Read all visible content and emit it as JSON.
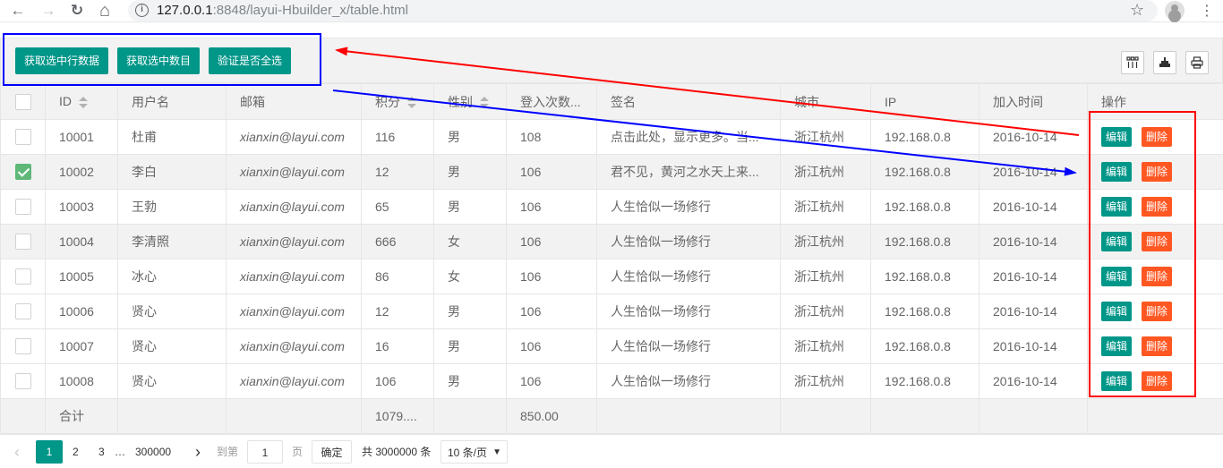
{
  "browser": {
    "back": "←",
    "forward": "→",
    "reload": "↻",
    "home": "⌂",
    "url_host": "127.0.0.1",
    "url_rest": ":8848/layui-Hbuilder_x/table.html",
    "star": "☆",
    "menu": "⋮"
  },
  "toolbar": {
    "btn_get_checked_data": "获取选中行数据",
    "btn_get_checked_count": "获取选中数目",
    "btn_check_all": "验证是否全选",
    "icons": [
      "columns-icon",
      "export-icon",
      "print-icon"
    ]
  },
  "table": {
    "headers": {
      "id": "ID",
      "username": "用户名",
      "email": "邮箱",
      "score": "积分",
      "sex": "性别",
      "logins": "登入次数...",
      "sign": "签名",
      "city": "城市",
      "ip": "IP",
      "join_time": "加入时间",
      "actions": "操作"
    },
    "rows": [
      {
        "checked": false,
        "id": "10001",
        "username": "杜甫",
        "email": "xianxin@layui.com",
        "score": "116",
        "sex": "男",
        "logins": "108",
        "sign": "点击此处，显示更多。当...",
        "city": "浙江杭州",
        "ip": "192.168.0.8",
        "join_time": "2016-10-14"
      },
      {
        "checked": true,
        "id": "10002",
        "username": "李白",
        "email": "xianxin@layui.com",
        "score": "12",
        "sex": "男",
        "logins": "106",
        "sign": "君不见，黄河之水天上来...",
        "city": "浙江杭州",
        "ip": "192.168.0.8",
        "join_time": "2016-10-14"
      },
      {
        "checked": false,
        "id": "10003",
        "username": "王勃",
        "email": "xianxin@layui.com",
        "score": "65",
        "sex": "男",
        "logins": "106",
        "sign": "人生恰似一场修行",
        "city": "浙江杭州",
        "ip": "192.168.0.8",
        "join_time": "2016-10-14"
      },
      {
        "checked": false,
        "id": "10004",
        "username": "李清照",
        "email": "xianxin@layui.com",
        "score": "666",
        "sex": "女",
        "logins": "106",
        "sign": "人生恰似一场修行",
        "city": "浙江杭州",
        "ip": "192.168.0.8",
        "join_time": "2016-10-14"
      },
      {
        "checked": false,
        "id": "10005",
        "username": "冰心",
        "email": "xianxin@layui.com",
        "score": "86",
        "sex": "女",
        "logins": "106",
        "sign": "人生恰似一场修行",
        "city": "浙江杭州",
        "ip": "192.168.0.8",
        "join_time": "2016-10-14"
      },
      {
        "checked": false,
        "id": "10006",
        "username": "贤心",
        "email": "xianxin@layui.com",
        "score": "12",
        "sex": "男",
        "logins": "106",
        "sign": "人生恰似一场修行",
        "city": "浙江杭州",
        "ip": "192.168.0.8",
        "join_time": "2016-10-14"
      },
      {
        "checked": false,
        "id": "10007",
        "username": "贤心",
        "email": "xianxin@layui.com",
        "score": "16",
        "sex": "男",
        "logins": "106",
        "sign": "人生恰似一场修行",
        "city": "浙江杭州",
        "ip": "192.168.0.8",
        "join_time": "2016-10-14"
      },
      {
        "checked": false,
        "id": "10008",
        "username": "贤心",
        "email": "xianxin@layui.com",
        "score": "106",
        "sex": "男",
        "logins": "106",
        "sign": "人生恰似一场修行",
        "city": "浙江杭州",
        "ip": "192.168.0.8",
        "join_time": "2016-10-14"
      }
    ],
    "row_actions": {
      "edit": "编辑",
      "delete": "删除"
    },
    "total": {
      "label": "合计",
      "score": "1079....",
      "logins": "850.00"
    }
  },
  "pager": {
    "prev": "‹",
    "pages": [
      "1",
      "2",
      "3"
    ],
    "ellipsis": "…",
    "last": "300000",
    "next": "›",
    "goto_label": "到第",
    "goto_value": "1",
    "page_unit": "页",
    "confirm": "确定",
    "total_text": "共 3000000 条",
    "limit": "10 条/页"
  },
  "annotation_colors": {
    "blue": "#0000ff",
    "red": "#ff0000"
  }
}
